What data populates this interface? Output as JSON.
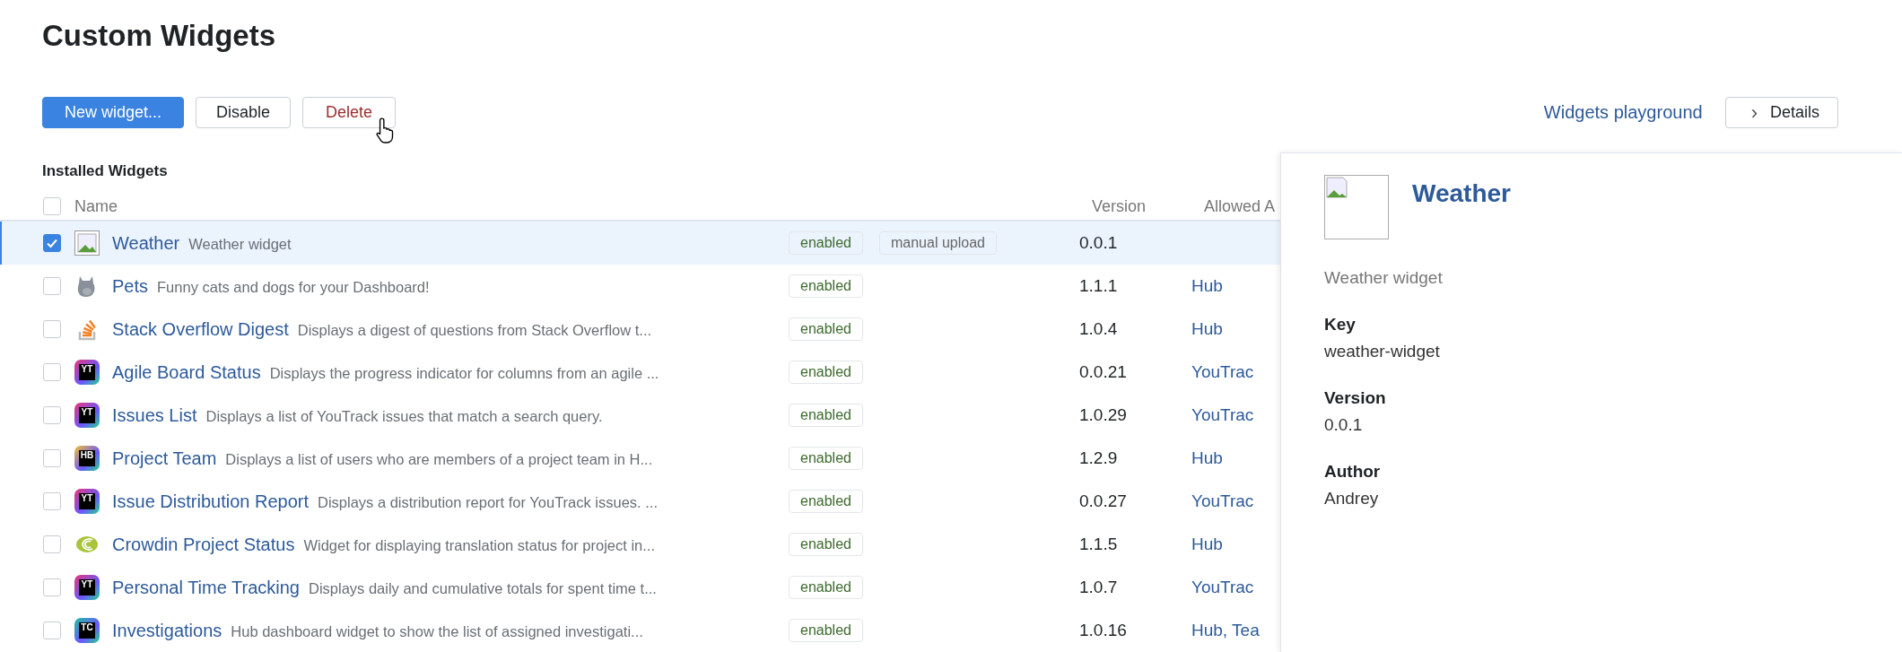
{
  "page": {
    "title": "Custom Widgets"
  },
  "toolbar": {
    "buttons": [
      {
        "label": "New widget...",
        "kind": "primary"
      },
      {
        "label": "Disable",
        "kind": "default"
      },
      {
        "label": "Delete",
        "kind": "danger"
      }
    ],
    "playground_link": "Widgets playground",
    "details_button": {
      "label": "Details",
      "icon": "›"
    }
  },
  "table": {
    "caption": "Installed Widgets",
    "select_all_checked": false,
    "columns": [
      "Name",
      "Version",
      "Allowed A"
    ],
    "rows": [
      {
        "name": "Weather",
        "description": "Weather widget",
        "icon": {
          "kind": "broken-image"
        },
        "selected": true,
        "checked": true,
        "badges": [
          "enabled",
          "manual upload"
        ],
        "version": "0.0.1"
      },
      {
        "name": "Pets",
        "description": "Funny cats and dogs for your Dashboard!",
        "icon": {
          "kind": "cat"
        },
        "selected": false,
        "checked": false,
        "badges": [
          "enabled"
        ],
        "version": "1.1.1",
        "allowed": "Hub"
      },
      {
        "name": "Stack Overflow Digest",
        "description": "Displays a digest of questions from Stack Overflow t...",
        "icon": {
          "kind": "stack"
        },
        "selected": false,
        "checked": false,
        "badges": [
          "enabled"
        ],
        "version": "1.0.4",
        "allowed": "Hub"
      },
      {
        "name": "Agile Board Status",
        "description": "Displays the progress indicator for columns from an agile ...",
        "icon": {
          "kind": "product",
          "letters": "YT"
        },
        "selected": false,
        "checked": false,
        "badges": [
          "enabled"
        ],
        "version": "0.0.21",
        "allowed": "YouTrac"
      },
      {
        "name": "Issues List",
        "description": "Displays a list of YouTrack issues that match a search query.",
        "icon": {
          "kind": "product",
          "letters": "YT"
        },
        "selected": false,
        "checked": false,
        "badges": [
          "enabled"
        ],
        "version": "1.0.29",
        "allowed": "YouTrac"
      },
      {
        "name": "Project Team",
        "description": "Displays a list of users who are members of a project team in H...",
        "icon": {
          "kind": "product",
          "letters": "HB"
        },
        "selected": false,
        "checked": false,
        "badges": [
          "enabled"
        ],
        "version": "1.2.9",
        "allowed": "Hub"
      },
      {
        "name": "Issue Distribution Report",
        "description": "Displays a distribution report for YouTrack issues. ...",
        "icon": {
          "kind": "product",
          "letters": "YT"
        },
        "selected": false,
        "checked": false,
        "badges": [
          "enabled"
        ],
        "version": "0.0.27",
        "allowed": "YouTrac"
      },
      {
        "name": "Crowdin Project Status",
        "description": "Widget for displaying translation status for project in...",
        "icon": {
          "kind": "crowdin"
        },
        "selected": false,
        "checked": false,
        "badges": [
          "enabled"
        ],
        "version": "1.1.5",
        "allowed": "Hub"
      },
      {
        "name": "Personal Time Tracking",
        "description": "Displays daily and cumulative totals for spent time t...",
        "icon": {
          "kind": "product",
          "letters": "YT"
        },
        "selected": false,
        "checked": false,
        "badges": [
          "enabled"
        ],
        "version": "1.0.7",
        "allowed": "YouTrac"
      },
      {
        "name": "Investigations",
        "description": "Hub dashboard widget to show the list of assigned investigati...",
        "icon": {
          "kind": "product",
          "letters": "TC"
        },
        "selected": false,
        "checked": false,
        "badges": [
          "enabled"
        ],
        "version": "1.0.16",
        "allowed": "Hub, Tea"
      }
    ]
  },
  "details_panel": {
    "title": "Weather",
    "description": "Weather widget",
    "fields": [
      {
        "label": "Key",
        "value": "weather-widget"
      },
      {
        "label": "Version",
        "value": "0.0.1"
      },
      {
        "label": "Author",
        "value": "Andrey"
      }
    ]
  }
}
